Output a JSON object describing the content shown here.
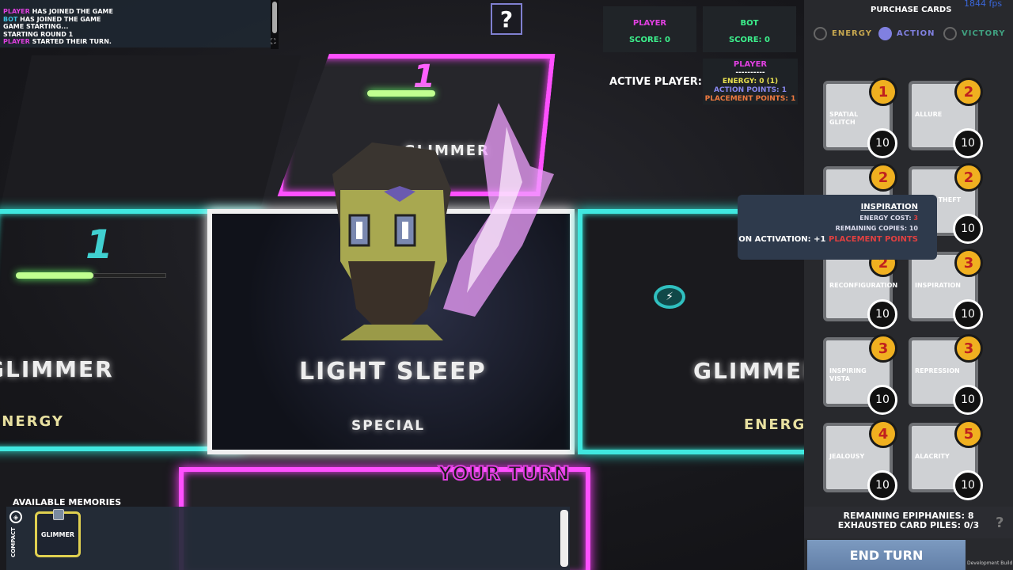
{
  "log": [
    {
      "who": "PLAYER",
      "text": " HAS JOINED THE GAME",
      "cls": "p"
    },
    {
      "who": "BOT",
      "text": " HAS JOINED THE GAME",
      "cls": "b"
    },
    {
      "who": "",
      "text": "GAME STARTING...",
      "cls": ""
    },
    {
      "who": "",
      "text": "STARTING ROUND 1",
      "cls": ""
    },
    {
      "who": "PLAYER",
      "text": " STARTED THEIR TURN.",
      "cls": "p"
    }
  ],
  "help_button": "?",
  "scores": {
    "player": {
      "name": "PLAYER",
      "score": "SCORE: 0",
      "color": "#e040e0"
    },
    "bot": {
      "name": "BOT",
      "score": "SCORE: 0",
      "color": "#3cf08c"
    }
  },
  "active": {
    "label": "ACTIVE PLAYER:",
    "name": "PLAYER",
    "divider": "----------",
    "energy": "ENERGY: 0 (1)",
    "action": "ACTION POINTS: 1",
    "placement": "PLACEMENT POINTS: 1"
  },
  "purchase": {
    "title": "PURCHASE CARDS",
    "fps": "1844 fps",
    "filters": [
      {
        "label": "ENERGY",
        "color": "#c8a850",
        "selected": false
      },
      {
        "label": "ACTION",
        "color": "#8080e0",
        "selected": true
      },
      {
        "label": "VICTORY",
        "color": "#40a080",
        "selected": false
      }
    ],
    "cards": [
      {
        "name": "SPATIAL GLITCH",
        "cost": "1",
        "copies": "10"
      },
      {
        "name": "ALLURE",
        "cost": "2",
        "copies": "10"
      },
      {
        "name": "",
        "cost": "2",
        "copies": "10"
      },
      {
        "name": "LIGHT THEFT",
        "cost": "2",
        "copies": "10"
      },
      {
        "name": "RECONFIGURATION",
        "cost": "2",
        "copies": "10"
      },
      {
        "name": "INSPIRATION",
        "cost": "3",
        "copies": "10"
      },
      {
        "name": "INSPIRING VISTA",
        "cost": "3",
        "copies": "10"
      },
      {
        "name": "REPRESSION",
        "cost": "3",
        "copies": "10"
      },
      {
        "name": "JEALOUSY",
        "cost": "4",
        "copies": "10"
      },
      {
        "name": "ALACRITY",
        "cost": "5",
        "copies": "10"
      }
    ]
  },
  "tooltip": {
    "title": "INSPIRATION",
    "energy_cost_label": "ENERGY COST: ",
    "energy_cost": "3",
    "remaining": "REMAINING COPIES: 10",
    "activation_label": "ON ACTIVATION: +1 ",
    "activation_value": "PLACEMENT POINTS"
  },
  "board": {
    "left_title": "GLIMMER",
    "left_type": "ENERGY",
    "left_num": "1",
    "center_title": "LIGHT SLEEP",
    "center_type": "SPECIAL",
    "top_title": "GLIMMER",
    "top_num": "1",
    "right_title": "GLIMMER",
    "right_type": "ENERGY",
    "your_turn": "YOUR TURN"
  },
  "footer": {
    "epiphanies": "REMAINING EPIPHANIES: 8",
    "exhausted": "EXHAUSTED CARD PILES: 0/3",
    "help": "?",
    "end_turn": "END TURN",
    "dev_build": "Development Build"
  },
  "memories": {
    "title": "AVAILABLE MEMORIES",
    "compact": "COMPACT",
    "cards": [
      "GLIMMER"
    ]
  }
}
